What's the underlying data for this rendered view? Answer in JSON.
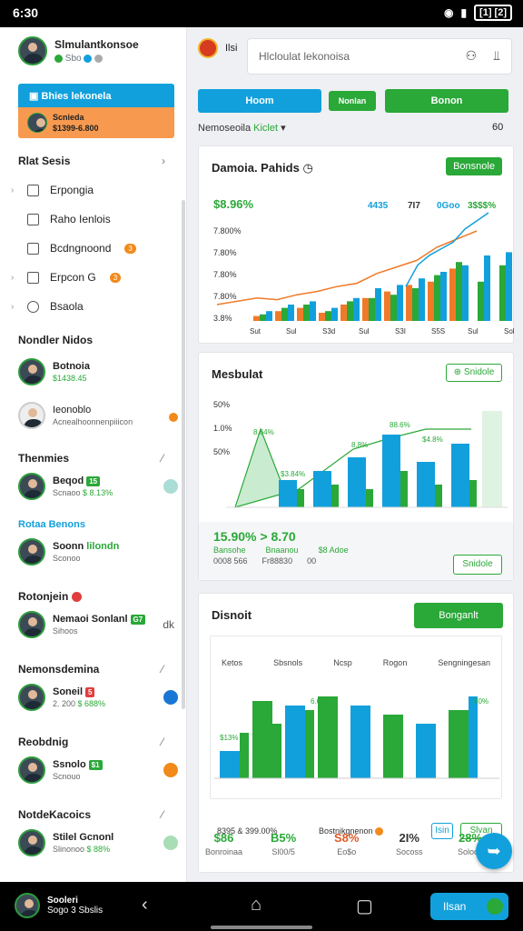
{
  "status": {
    "time": "6:30",
    "battery": "[1] [2]"
  },
  "profile": {
    "name": "Slmulantkonsoe",
    "sub": "Sbo"
  },
  "sidebar": {
    "account": {
      "title": "Bhies lekonela",
      "name": "Scnieda",
      "number": "$1399-6.800"
    },
    "sections": [
      "Rlat Sesis",
      "Nondler Nidos",
      "Thenmies",
      "Rotonjein",
      "Nemonsdemina",
      "Reobdnig",
      "NotdeKacoics"
    ],
    "section_link": "Rotaa Benons",
    "nav": [
      "Erpongia",
      "Raho Ienlois",
      "Bcdngnoond",
      "Erpcon G",
      "Bsaola"
    ],
    "contacts": [
      {
        "name": "Botnoia",
        "sub": "$1438.45",
        "tag": "5"
      },
      {
        "name": "Ieonoblo",
        "sub": "Acnealhoonnenpiiicon"
      },
      {
        "name": "Beqod",
        "sub": "Scnaoo",
        "tag": "$ 8.13%"
      },
      {
        "name": "Soonn",
        "sub": "Sconoo",
        "tag": "lilondn"
      },
      {
        "name": "Nemaoi Sonlanl",
        "sub": "Sihoos",
        "tag": "G7"
      },
      {
        "name": "Soneil",
        "sub": "2. 200 ",
        "tag": "$ 688%"
      },
      {
        "name": "Ssnolo",
        "sub": "Scnouo",
        "tag": "$1"
      },
      {
        "name": "Stilel Gcnonl",
        "sub": "Slinonoo",
        "tag": "$ 88%"
      }
    ]
  },
  "header": {
    "app": "Ilsi",
    "search_placeholder": "Hlcloulat lekonoisa"
  },
  "buttons": {
    "b1": "Hoom",
    "b2": "Nonlan",
    "b3": "Bonon"
  },
  "filter": {
    "label": "Nemoseoila",
    "value": "Kiclet",
    "count": "60"
  },
  "card1": {
    "title": "Damoia. Pahids",
    "button": "Bonsnole",
    "headline": "$8.96%",
    "head2": "4435",
    "head3": "7I7",
    "head4": "0Goo",
    "head5": "3$$$%"
  },
  "card2": {
    "title": "Mesbulat",
    "button": "Snidole",
    "big": "15.90% > 8.70",
    "l1": "Bansohe",
    "l2": "Bnaanou",
    "l3": "$8 Adoe",
    "v1": "0008 566",
    "v2": "Fr88830",
    "v3": "00"
  },
  "card3": {
    "title": "Disnoit",
    "button": "Bonganlt",
    "cols": [
      "Ketos",
      "Sbsnols",
      "Ncsp",
      "Rogon",
      "Sengningesan"
    ],
    "footer_left": "8395 & 399.00%",
    "footer_mid": "Bostnikgnenon",
    "btn_a": "Isin",
    "btn_b": "Slvan"
  },
  "stats": [
    {
      "v": "$86",
      "s": "Bonroinaa"
    },
    {
      "v": "B5%",
      "s": "Sl00/5"
    },
    {
      "v": "S8%",
      "s": "Eo$o"
    },
    {
      "v": "2I%",
      "s": "Socoss"
    },
    {
      "v": "28%",
      "s": "Soloop"
    }
  ],
  "bottom": {
    "user": "Sooleri",
    "user_sub": "Sogo 3 Sbslis",
    "done": "Ilsan"
  },
  "chart_data": [
    {
      "type": "bar",
      "title": "Damoia. Pahids",
      "ylabels": [
        "7.800%",
        "7.80%",
        "7.80%",
        "7.80%",
        "3.8%"
      ],
      "categories": [
        "Sut",
        "Sul",
        "S3d",
        "Sul",
        "S3I",
        "S5S",
        "Sul",
        "Sol"
      ],
      "series": [
        {
          "name": "green",
          "values": [
            4,
            8,
            10,
            6,
            12,
            14,
            16,
            20,
            28,
            36,
            24,
            34
          ]
        },
        {
          "name": "blue",
          "values": [
            6,
            10,
            12,
            8,
            14,
            20,
            22,
            26,
            30,
            34,
            40,
            42
          ]
        },
        {
          "name": "orange",
          "values": [
            3,
            6,
            8,
            5,
            10,
            14,
            18,
            22,
            24,
            32,
            0,
            0
          ]
        }
      ],
      "line": [
        20,
        24,
        28,
        26,
        32,
        36,
        42,
        46,
        58,
        66,
        74,
        90,
        100,
        110
      ]
    },
    {
      "type": "bar",
      "title": "Mesbulat",
      "ylabels": [
        "50%",
        "1.0%",
        "50%"
      ],
      "values": [
        [
          30,
          20
        ],
        [
          40,
          25
        ],
        [
          55,
          20
        ],
        [
          80,
          40
        ],
        [
          50,
          25
        ],
        [
          70,
          30
        ]
      ],
      "labels": [
        "8.64%",
        "$3.84%",
        "8.8%",
        "88.6%",
        "$4.8%"
      ]
    },
    {
      "type": "bar",
      "title": "Disnoit",
      "values": [
        [
          30,
          50
        ],
        [
          85,
          60
        ],
        [
          80,
          75
        ],
        [
          90,
          0
        ],
        [
          80,
          0
        ],
        [
          70,
          0
        ],
        [
          60,
          0
        ],
        [
          75,
          90
        ]
      ],
      "labels": [
        "$13%",
        "6.6%",
        "80%"
      ]
    }
  ]
}
